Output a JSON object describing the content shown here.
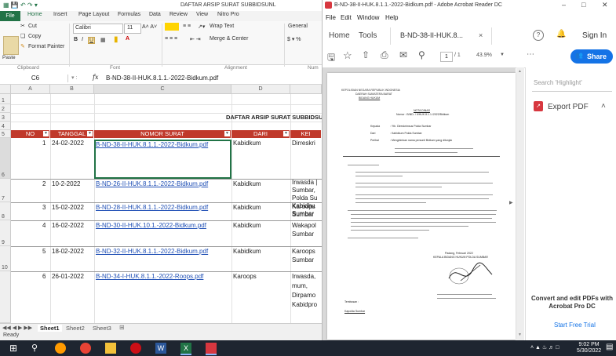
{
  "excel": {
    "title": "DAFTAR ARSIP SURAT SUBBIDSUNL",
    "tabs": [
      "File",
      "Home",
      "Insert",
      "Page Layout",
      "Formulas",
      "Data",
      "Review",
      "View",
      "Nitro Pro"
    ],
    "ribbon": {
      "cut": "Cut",
      "copy": "Copy",
      "paste": "Paste",
      "format_painter": "Format Painter",
      "font_name": "Calibri",
      "font_size": "11",
      "wrap_text": "Wrap Text",
      "merge_center": "Merge & Center",
      "number_format": "General",
      "groups": {
        "clipboard": "Clipboard",
        "font": "Font",
        "alignment": "Alignment",
        "number": "Num"
      }
    },
    "name_box": "C6",
    "formula_fx": "fx",
    "formula": "B-ND-38-II-HUK.8.1.1.-2022-Bidkum.pdf",
    "columns": [
      "A",
      "B",
      "C",
      "D",
      ""
    ],
    "row_numbers": [
      "1",
      "2",
      "3",
      "4",
      "5",
      "6",
      "7",
      "8",
      "9",
      "10"
    ],
    "sheet_title": "DAFTAR ARSIP SURAT SUBBIDSUN",
    "headers": [
      "NO",
      "TANGGAL",
      "NOMOR SURAT",
      "DARI",
      "KEI"
    ],
    "rows": [
      {
        "no": "1",
        "date": "24-02-2022",
        "file": "B-ND-38-II-HUK.8.1.1.-2022-Bidkum.pdf",
        "from": "Kabidkum",
        "to": "Dirreskri"
      },
      {
        "no": "2",
        "date": "10-2-2022",
        "file": "B-ND-26-II-HUK.8.1.1.-2022-Bidkum.pdf",
        "from": "Kabidkum",
        "to": "Irwasda | Sumbar, Polda Su Kabidhu Sumbar"
      },
      {
        "no": "3",
        "date": "15-02-2022",
        "file": "B-ND-28-II-HUK.8.1.1.-2022-Bidkum.pdf",
        "from": "Kabidkum",
        "to": "Karoops Sumbar"
      },
      {
        "no": "4",
        "date": "16-02-2022",
        "file": "B-ND-30-II-HUK.10.1.-2022-Bidkum.pdf",
        "from": "Kabidkum",
        "to": "Wakapol Sumbar"
      },
      {
        "no": "5",
        "date": "18-02-2022",
        "file": "B-ND-32-II-HUK.8.1.1.-2022-Bidkum.pdf",
        "from": "Kabidkum",
        "to": "Karoops Sumbar"
      },
      {
        "no": "6",
        "date": "26-01-2022",
        "file": "B-ND-34-I-HUK.8.1.1.-2022-Roops.pdf",
        "from": "Karoops",
        "to": "Irwasda, mum, Dirpamo Kabidpro"
      }
    ],
    "row2_to_lines": [
      "Irwasda |",
      "Sumbar,",
      "Polda Su",
      "Kabidhu",
      "Sumbar"
    ],
    "row6_to_lines": [
      "Irwasda,",
      "mum,",
      "Dirpamo",
      "Kabidpro"
    ],
    "sheets": [
      "Sheet1",
      "Sheet2",
      "Sheet3"
    ],
    "status": "Ready"
  },
  "acrobat": {
    "title": "B-ND-38-II-HUK.8.1.1.-2022-Bidkum.pdf - Adobe Acrobat Reader DC",
    "menu": [
      "File",
      "Edit",
      "Window",
      "Help"
    ],
    "tabs": {
      "home": "Home",
      "tools": "Tools",
      "doc": "B-ND-38-II-HUK.8...",
      "sign_in": "Sign In"
    },
    "page_current": "1",
    "page_total": "/ 1",
    "zoom": "43.9%",
    "share": "Share",
    "search_placeholder": "Search 'Highlight'",
    "export_pdf": "Export PDF",
    "convert_title": "Convert and edit PDFs with Acrobat Pro DC",
    "free_trial": "Start Free Trial",
    "doc_header": [
      "KEPOLISIAN NEGARA REPUBLIK INDONESIA",
      "DAERAH SUMATERA BARAT",
      "BIDANG HUKUM"
    ],
    "doc_title": "NOTA DINAS",
    "doc_number": "Nomor : B/ND-    / II/HUK 8.1.1./2022/Bidkum",
    "doc_fields": [
      "Kepada",
      "Dari",
      "Perihal"
    ],
    "doc_values": [
      ": Yth. Direskrimsus Polda Sumbar",
      ": Kabidkum Polda Sumbar",
      ": Mengirimkan nama personil Bidkum yang ditunjuk"
    ],
    "doc_sign_place": "Padang,    Februari 2022",
    "doc_sign_role": "KEPALA BIDANG HUKUM POLDA SUMBAR",
    "doc_tembusan": "Tembusan :",
    "doc_tembusan_item": "Kapolda Sumbar"
  },
  "taskbar": {
    "time": "9:02 PM",
    "date": "5/30/2022"
  },
  "colors": {
    "excel_green": "#217346",
    "header_red": "#c0392b",
    "acro_blue": "#1473e6",
    "acro_red": "#d7373f"
  }
}
